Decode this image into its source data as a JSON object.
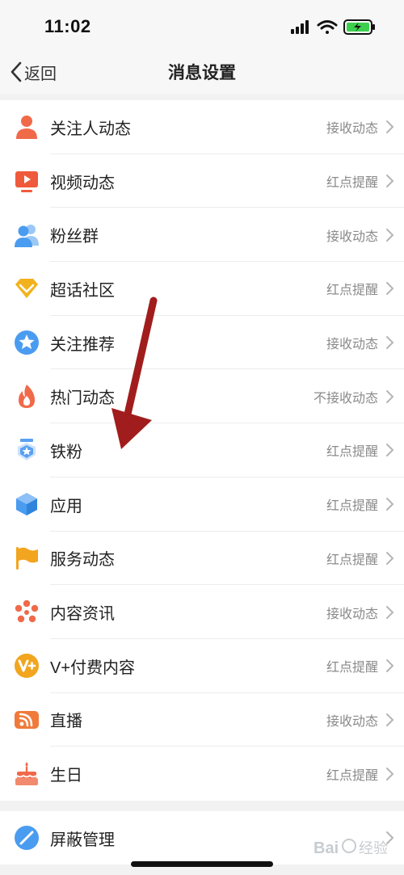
{
  "status_bar": {
    "time": "11:02"
  },
  "nav": {
    "back_label": "返回",
    "title": "消息设置"
  },
  "items": [
    {
      "label": "关注人动态",
      "value": "接收动态",
      "icon": "person-icon",
      "color": "#f06a4a"
    },
    {
      "label": "视频动态",
      "value": "红点提醒",
      "icon": "video-play-icon",
      "color": "#ef5a3c"
    },
    {
      "label": "粉丝群",
      "value": "接收动态",
      "icon": "group-icon",
      "color": "#4a9cf0"
    },
    {
      "label": "超话社区",
      "value": "红点提醒",
      "icon": "diamond-icon",
      "color": "#f2b21e"
    },
    {
      "label": "关注推荐",
      "value": "接收动态",
      "icon": "star-badge-icon",
      "color": "#4a9cf0"
    },
    {
      "label": "热门动态",
      "value": "不接收动态",
      "icon": "flame-icon",
      "color": "#f06a4a"
    },
    {
      "label": "铁粉",
      "value": "红点提醒",
      "icon": "shield-star-icon",
      "color": "#5aa0f2"
    },
    {
      "label": "应用",
      "value": "红点提醒",
      "icon": "cube-icon",
      "color": "#4a9cf0"
    },
    {
      "label": "服务动态",
      "value": "红点提醒",
      "icon": "flag-icon",
      "color": "#f2a51e"
    },
    {
      "label": "内容资讯",
      "value": "接收动态",
      "icon": "flower-icon",
      "color": "#f06a4a"
    },
    {
      "label": "V+付费内容",
      "value": "红点提醒",
      "icon": "v-plus-icon",
      "color": "#f2a51e"
    },
    {
      "label": "直播",
      "value": "接收动态",
      "icon": "live-broadcast-icon",
      "color": "#f07a3a"
    },
    {
      "label": "生日",
      "value": "红点提醒",
      "icon": "cake-icon",
      "color": "#f06a4a"
    }
  ],
  "blocked": {
    "label": "屏蔽管理",
    "icon": "block-icon",
    "color": "#4a9cf0"
  },
  "watermark": "Bai 经验"
}
